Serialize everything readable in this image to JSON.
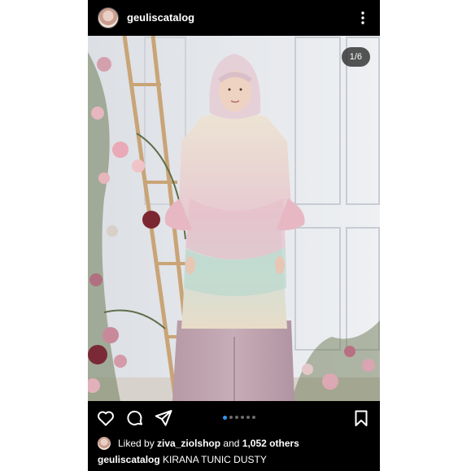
{
  "post": {
    "username": "geuliscatalog",
    "image_counter": "1/6",
    "carousel": {
      "count": 6,
      "active_index": 0
    }
  },
  "likes": {
    "prefix": "Liked by",
    "liker": "ziva_ziolshop",
    "connector": "and",
    "others": "1,052 others"
  },
  "caption": {
    "username": "geuliscatalog",
    "text": "KIRANA TUNIC DUSTY"
  },
  "icons": {
    "more": "more-vertical-icon",
    "like": "heart-icon",
    "comment": "comment-icon",
    "share": "send-icon",
    "save": "bookmark-icon"
  },
  "colors": {
    "background": "#000000",
    "text": "#ffffff",
    "active_dot": "#2f97f4",
    "inactive_dot": "#6b6b6b"
  }
}
